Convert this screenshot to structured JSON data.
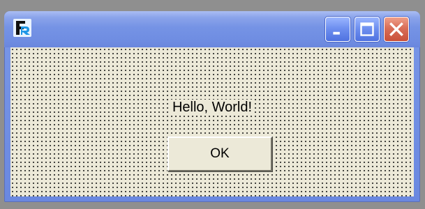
{
  "window": {
    "title": "",
    "icon": "app-logo-icon",
    "controls": {
      "minimize": "minimize-icon",
      "maximize": "maximize-icon",
      "close": "close-icon"
    },
    "colors": {
      "titlebar": "#7593e5",
      "client_background": "#ece9d8",
      "close_button": "#d96e58",
      "grid_dot": "#1a1a1a"
    }
  },
  "content": {
    "message": "Hello, World!",
    "ok_label": "OK"
  }
}
